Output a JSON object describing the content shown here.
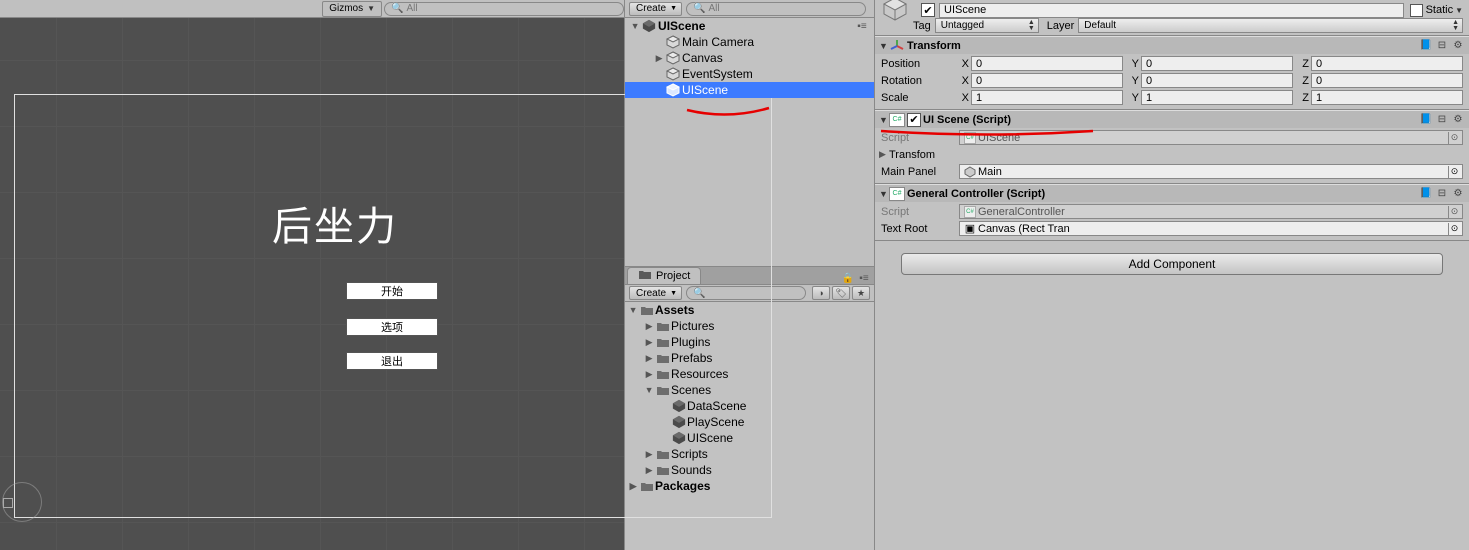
{
  "scene_toolbar": {
    "gizmos_label": "Gizmos",
    "search_placeholder": "All"
  },
  "game_preview": {
    "title": "后坐力",
    "buttons": [
      "开始",
      "选项",
      "退出"
    ]
  },
  "hierarchy": {
    "create_label": "Create",
    "search_placeholder": "All",
    "scene_name": "UIScene",
    "items": [
      {
        "name": "Main Camera",
        "expandable": false
      },
      {
        "name": "Canvas",
        "expandable": true
      },
      {
        "name": "EventSystem",
        "expandable": false
      },
      {
        "name": "UIScene",
        "expandable": false,
        "selected": true
      }
    ]
  },
  "project": {
    "tab_label": "Project",
    "create_label": "Create",
    "tree": [
      {
        "name": "Assets",
        "depth": 0,
        "open": true,
        "folder": true
      },
      {
        "name": "Pictures",
        "depth": 1,
        "open": false,
        "folder": true
      },
      {
        "name": "Plugins",
        "depth": 1,
        "open": false,
        "folder": true
      },
      {
        "name": "Prefabs",
        "depth": 1,
        "open": false,
        "folder": true
      },
      {
        "name": "Resources",
        "depth": 1,
        "open": false,
        "folder": true
      },
      {
        "name": "Scenes",
        "depth": 1,
        "open": true,
        "folder": true
      },
      {
        "name": "DataScene",
        "depth": 2,
        "open": false,
        "folder": false,
        "unity": true
      },
      {
        "name": "PlayScene",
        "depth": 2,
        "open": false,
        "folder": false,
        "unity": true
      },
      {
        "name": "UIScene",
        "depth": 2,
        "open": false,
        "folder": false,
        "unity": true
      },
      {
        "name": "Scripts",
        "depth": 1,
        "open": false,
        "folder": true
      },
      {
        "name": "Sounds",
        "depth": 1,
        "open": false,
        "folder": true
      },
      {
        "name": "Packages",
        "depth": 0,
        "open": false,
        "folder": true
      }
    ]
  },
  "inspector": {
    "object_name": "UIScene",
    "static_label": "Static",
    "tag_label": "Tag",
    "tag_value": "Untagged",
    "layer_label": "Layer",
    "layer_value": "Default",
    "transform": {
      "title": "Transform",
      "position_label": "Position",
      "pos": {
        "x": "0",
        "y": "0",
        "z": "0"
      },
      "rotation_label": "Rotation",
      "rot": {
        "x": "0",
        "y": "0",
        "z": "0"
      },
      "scale_label": "Scale",
      "scl": {
        "x": "1",
        "y": "1",
        "z": "1"
      }
    },
    "uiscene": {
      "enabled": true,
      "title": "UI Scene (Script)",
      "script_label": "Script",
      "script_value": "UIScene",
      "transform_label": "Transfom",
      "mainpanel_label": "Main Panel",
      "mainpanel_value": "Main"
    },
    "generalcontroller": {
      "title": "General Controller (Script)",
      "script_label": "Script",
      "script_value": "GeneralController",
      "textroot_label": "Text Root",
      "textroot_value": "Canvas (Rect Tran"
    },
    "add_component": "Add Component"
  }
}
